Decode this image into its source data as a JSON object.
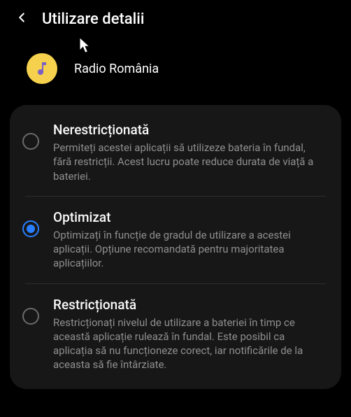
{
  "header": {
    "title": "Utilizare detalii"
  },
  "app": {
    "name": "Radio România"
  },
  "options": [
    {
      "title": "Nerestricționată",
      "description": "Permiteți acestei aplicații să utilizeze bateria în fundal, fără restricții. Acest lucru poate reduce durata de viață a bateriei.",
      "selected": false
    },
    {
      "title": "Optimizat",
      "description": "Optimizați în funcție de gradul de utilizare a acestei aplicații. Opțiune recomandată pentru majoritatea aplicațiilor.",
      "selected": true
    },
    {
      "title": "Restricționată",
      "description": "Restricționați nivelul de utilizare a bateriei în timp ce această aplicație rulează în fundal. Este posibil ca aplicația să nu funcționeze corect, iar notificările de la aceasta să fie întârziate.",
      "selected": false
    }
  ]
}
